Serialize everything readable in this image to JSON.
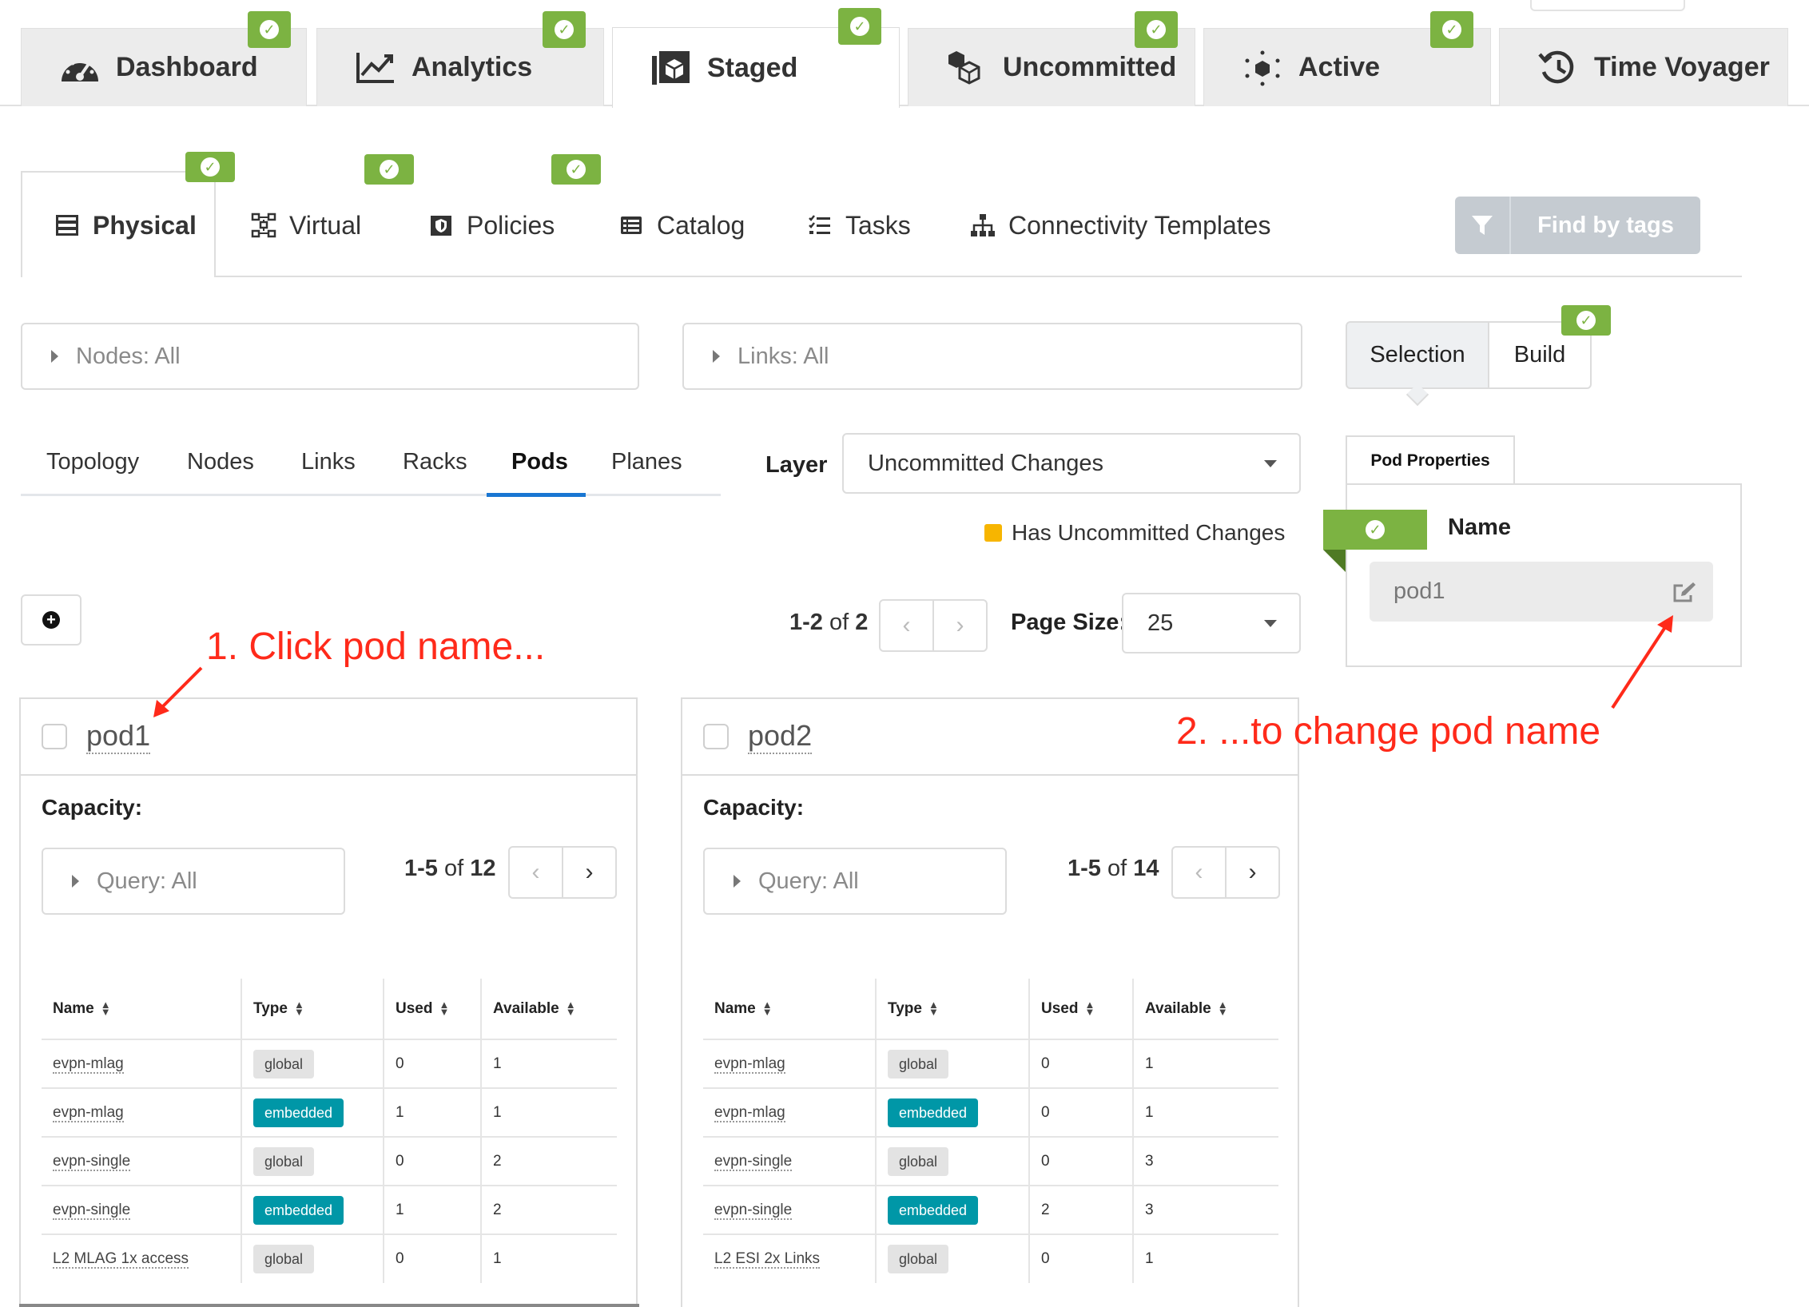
{
  "top_tabs": [
    {
      "label": "Dashboard",
      "icon": "gauge-icon"
    },
    {
      "label": "Analytics",
      "icon": "chart-icon"
    },
    {
      "label": "Staged",
      "icon": "cube-stack-icon"
    },
    {
      "label": "Uncommitted",
      "icon": "cubes-icon"
    },
    {
      "label": "Active",
      "icon": "active-cube-icon"
    },
    {
      "label": "Time Voyager",
      "icon": "history-icon"
    }
  ],
  "sub_tabs": [
    {
      "label": "Physical",
      "icon": "server-icon"
    },
    {
      "label": "Virtual",
      "icon": "network-icon"
    },
    {
      "label": "Policies",
      "icon": "shield-icon"
    },
    {
      "label": "Catalog",
      "icon": "catalog-icon"
    },
    {
      "label": "Tasks",
      "icon": "tasks-icon"
    },
    {
      "label": "Connectivity Templates",
      "icon": "sitemap-icon"
    }
  ],
  "find_by_tags": "Find by tags",
  "filters": {
    "nodes": "Nodes: All",
    "links": "Links: All"
  },
  "selection_build": {
    "selection": "Selection",
    "build": "Build"
  },
  "view_tabs": [
    "Topology",
    "Nodes",
    "Links",
    "Racks",
    "Pods",
    "Planes"
  ],
  "layer": {
    "label": "Layer",
    "value": "Uncommitted Changes"
  },
  "legend": {
    "label": "Has Uncommitted Changes",
    "color": "#f7b500"
  },
  "pod_properties": {
    "tab": "Pod Properties",
    "name_label": "Name",
    "name_value": "pod1"
  },
  "pager": {
    "range": "1-2",
    "of_word": "of",
    "total": "2",
    "page_size_label": "Page Size:",
    "page_size": "25"
  },
  "annotations": {
    "step1": "1. Click pod name...",
    "step2": "2. ...to change pod name"
  },
  "columns": [
    "Name",
    "Type",
    "Used",
    "Available"
  ],
  "pods": [
    {
      "name": "pod1",
      "capacity_label": "Capacity:",
      "query": "Query: All",
      "range": "1-5",
      "of_word": "of",
      "total": "12",
      "rows": [
        {
          "name": "evpn-mlag",
          "type": "global",
          "used": "0",
          "available": "1"
        },
        {
          "name": "evpn-mlag",
          "type": "embedded",
          "used": "1",
          "available": "1"
        },
        {
          "name": "evpn-single",
          "type": "global",
          "used": "0",
          "available": "2"
        },
        {
          "name": "evpn-single",
          "type": "embedded",
          "used": "1",
          "available": "2"
        },
        {
          "name": "L2 MLAG 1x access",
          "type": "global",
          "used": "0",
          "available": "1"
        }
      ]
    },
    {
      "name": "pod2",
      "capacity_label": "Capacity:",
      "query": "Query: All",
      "range": "1-5",
      "of_word": "of",
      "total": "14",
      "rows": [
        {
          "name": "evpn-mlag",
          "type": "global",
          "used": "0",
          "available": "1"
        },
        {
          "name": "evpn-mlag",
          "type": "embedded",
          "used": "0",
          "available": "1"
        },
        {
          "name": "evpn-single",
          "type": "global",
          "used": "0",
          "available": "3"
        },
        {
          "name": "evpn-single",
          "type": "embedded",
          "used": "2",
          "available": "3"
        },
        {
          "name": "L2 ESI 2x Links",
          "type": "global",
          "used": "0",
          "available": "1"
        }
      ]
    }
  ],
  "colors": {
    "accent": "#1976d2",
    "badge_green": "#7cb342",
    "embedded": "#0097a7",
    "annotation": "#ff2a1a"
  }
}
